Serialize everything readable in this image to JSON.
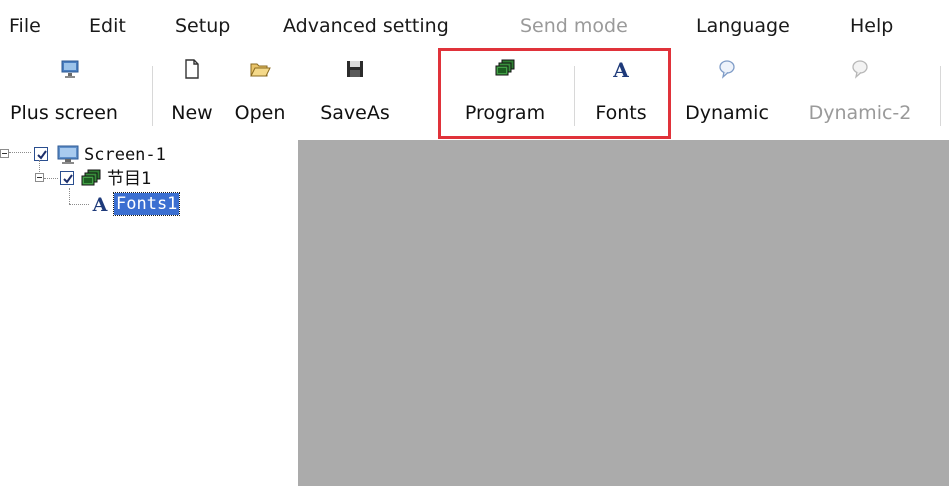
{
  "menu": {
    "items": [
      {
        "label": "File",
        "enabled": true
      },
      {
        "label": "Edit",
        "enabled": true
      },
      {
        "label": "Setup",
        "enabled": true
      },
      {
        "label": "Advanced setting",
        "enabled": true
      },
      {
        "label": "Send mode",
        "enabled": false
      },
      {
        "label": "Language",
        "enabled": true
      },
      {
        "label": "Help",
        "enabled": true
      }
    ]
  },
  "toolbar": {
    "items": [
      {
        "label": "Plus screen",
        "icon": "screen-icon",
        "enabled": true
      },
      {
        "label": "New",
        "icon": "new-file-icon",
        "enabled": true
      },
      {
        "label": "Open",
        "icon": "open-folder-icon",
        "enabled": true
      },
      {
        "label": "SaveAs",
        "icon": "floppy-disk-icon",
        "enabled": true
      },
      {
        "label": "Program",
        "icon": "program-stack-icon",
        "enabled": true
      },
      {
        "label": "Fonts",
        "icon": "font-a-icon",
        "enabled": true
      },
      {
        "label": "Dynamic",
        "icon": "speech-bubble-icon",
        "enabled": true
      },
      {
        "label": "Dynamic-2",
        "icon": "speech-bubble-icon",
        "enabled": false
      }
    ],
    "highlight_color": "#e0323a"
  },
  "tree": {
    "screen": {
      "label": "Screen-1",
      "checked": true
    },
    "program": {
      "label": "节目1",
      "checked": true
    },
    "fonts": {
      "label": "Fonts1",
      "selected": true
    }
  },
  "colors": {
    "workspace": "#ababab",
    "selection": "#3b6fd1"
  }
}
